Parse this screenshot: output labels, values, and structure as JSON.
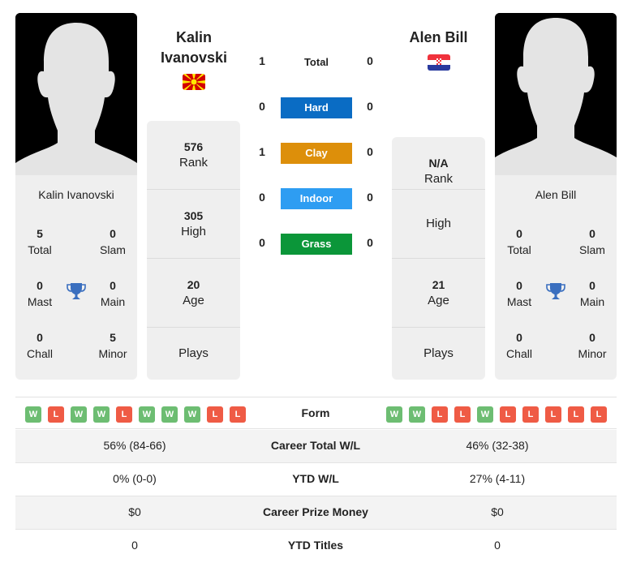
{
  "player1": {
    "name_line1": "Kalin",
    "name_line2": "Ivanovski",
    "card_name": "Kalin Ivanovski",
    "flag": "north-macedonia-flag",
    "titles": {
      "total": {
        "value": "5",
        "label": "Total"
      },
      "slam": {
        "value": "0",
        "label": "Slam"
      },
      "mast": {
        "value": "0",
        "label": "Mast"
      },
      "main": {
        "value": "0",
        "label": "Main"
      },
      "chall": {
        "value": "0",
        "label": "Chall"
      },
      "minor": {
        "value": "5",
        "label": "Minor"
      }
    },
    "rank": {
      "value": "576",
      "label": "Rank"
    },
    "high": {
      "value": "305",
      "label": "High"
    },
    "age": {
      "value": "20",
      "label": "Age"
    },
    "plays": {
      "value": "",
      "label": "Plays"
    },
    "form": [
      "W",
      "L",
      "W",
      "W",
      "L",
      "W",
      "W",
      "W",
      "L",
      "L"
    ]
  },
  "player2": {
    "name": "Alen Bill",
    "card_name": "Alen Bill",
    "flag": "croatia-flag",
    "titles": {
      "total": {
        "value": "0",
        "label": "Total"
      },
      "slam": {
        "value": "0",
        "label": "Slam"
      },
      "mast": {
        "value": "0",
        "label": "Mast"
      },
      "main": {
        "value": "0",
        "label": "Main"
      },
      "chall": {
        "value": "0",
        "label": "Chall"
      },
      "minor": {
        "value": "0",
        "label": "Minor"
      }
    },
    "rank": {
      "value": "N/A",
      "label": "Rank"
    },
    "high": {
      "value": "",
      "label": "High"
    },
    "age": {
      "value": "21",
      "label": "Age"
    },
    "plays": {
      "value": "",
      "label": "Plays"
    },
    "form": [
      "W",
      "W",
      "L",
      "L",
      "W",
      "L",
      "L",
      "L",
      "L",
      "L"
    ]
  },
  "h2h": {
    "total": {
      "label": "Total",
      "p1": "1",
      "p2": "0"
    },
    "surfaces": [
      {
        "label": "Hard",
        "p1": "0",
        "p2": "0",
        "color": "#0a6cc4"
      },
      {
        "label": "Clay",
        "p1": "1",
        "p2": "0",
        "color": "#dd8f0a"
      },
      {
        "label": "Indoor",
        "p1": "0",
        "p2": "0",
        "color": "#2e9df2"
      },
      {
        "label": "Grass",
        "p1": "0",
        "p2": "0",
        "color": "#0b9639"
      }
    ]
  },
  "form_label": "Form",
  "stats": [
    {
      "label": "Career Total W/L",
      "p1": "56% (84-66)",
      "p2": "46% (32-38)"
    },
    {
      "label": "YTD W/L",
      "p1": "0% (0-0)",
      "p2": "27% (4-11)"
    },
    {
      "label": "Career Prize Money",
      "p1": "$0",
      "p2": "$0"
    },
    {
      "label": "YTD Titles",
      "p1": "0",
      "p2": "0"
    }
  ],
  "colors": {
    "win": "#6dbd72",
    "loss": "#ef5b45",
    "trophy": "#3a6fbf",
    "card_bg": "#efefef"
  }
}
